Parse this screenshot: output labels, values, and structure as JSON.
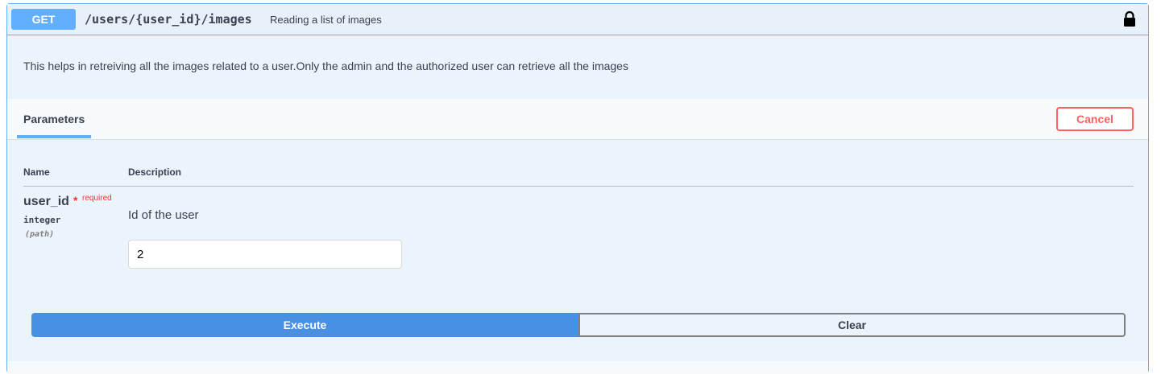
{
  "operation": {
    "method": "GET",
    "path": "/users/{user_id}/images",
    "summary": "Reading a list of images",
    "lock_icon": "lock-icon",
    "description": "This helps in retreiving all the images related to a user.Only the admin and the authorized user can retrieve all the images"
  },
  "parameters": {
    "tab_label": "Parameters",
    "cancel_label": "Cancel",
    "columns": {
      "name": "Name",
      "description": "Description"
    },
    "items": [
      {
        "name": "user_id",
        "required_star": "*",
        "required_label": "required",
        "type": "integer",
        "in": "(path)",
        "description": "Id of the user",
        "value": "2"
      }
    ]
  },
  "actions": {
    "execute_label": "Execute",
    "clear_label": "Clear"
  },
  "colors": {
    "get_accent": "#61affe",
    "cancel_red": "#ff6060",
    "required_red": "#ff3030",
    "execute_blue": "#4990e2"
  }
}
